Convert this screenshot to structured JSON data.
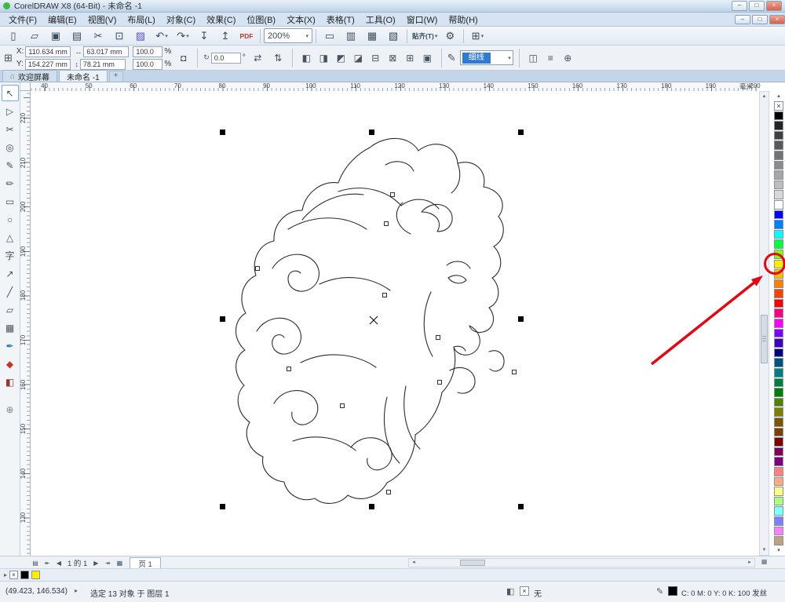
{
  "ui": {
    "drop_glyph": "▾"
  },
  "window": {
    "title": "CorelDRAW X8 (64-Bit) - 未命名 -1",
    "accent_green": "#43b649",
    "min_glyph": "–",
    "max_glyph": "□",
    "close_glyph": "×"
  },
  "menubar": {
    "items": [
      {
        "key": "file",
        "label": "文件(F)"
      },
      {
        "key": "edit",
        "label": "编辑(E)"
      },
      {
        "key": "view",
        "label": "视图(V)"
      },
      {
        "key": "layout",
        "label": "布局(L)"
      },
      {
        "key": "object",
        "label": "对象(C)"
      },
      {
        "key": "effects",
        "label": "效果(C)"
      },
      {
        "key": "bitmaps",
        "label": "位图(B)"
      },
      {
        "key": "text",
        "label": "文本(X)"
      },
      {
        "key": "table",
        "label": "表格(T)"
      },
      {
        "key": "tools",
        "label": "工具(O)"
      },
      {
        "key": "window",
        "label": "窗口(W)"
      },
      {
        "key": "help",
        "label": "帮助(H)"
      }
    ]
  },
  "toolbar": {
    "items": [
      {
        "name": "new-document-button",
        "glyph": "▯",
        "type": "icon"
      },
      {
        "name": "open-button",
        "glyph": "▱",
        "type": "icon"
      },
      {
        "name": "save-button",
        "glyph": "▣",
        "type": "icon"
      },
      {
        "name": "print-button",
        "glyph": "▤",
        "type": "icon"
      },
      {
        "name": "cut-button",
        "glyph": "✂",
        "type": "icon"
      },
      {
        "name": "copy-button",
        "glyph": "⊡",
        "type": "icon"
      },
      {
        "name": "paste-button",
        "glyph": "▨",
        "type": "icon",
        "accent": "#5a4fcf"
      },
      {
        "name": "undo-button",
        "glyph": "↶",
        "type": "icon-drop"
      },
      {
        "name": "redo-button",
        "glyph": "↷",
        "type": "icon-drop"
      },
      {
        "name": "import-button",
        "glyph": "↧",
        "type": "icon"
      },
      {
        "name": "export-button",
        "glyph": "↥",
        "type": "icon"
      },
      {
        "name": "publish-pdf-button",
        "glyph": "PDF",
        "type": "text",
        "accent": "#c0392b"
      },
      {
        "type": "sep"
      },
      {
        "name": "zoom-level-select",
        "glyph": "200%",
        "type": "select"
      },
      {
        "type": "sep"
      },
      {
        "name": "full-screen-preview-button",
        "glyph": "▭",
        "type": "icon"
      },
      {
        "name": "show-rulers-button",
        "glyph": "▥",
        "type": "icon"
      },
      {
        "name": "show-grid-button",
        "glyph": "▦",
        "type": "icon"
      },
      {
        "name": "show-guidelines-button",
        "glyph": "▧",
        "type": "icon"
      },
      {
        "type": "sep"
      },
      {
        "name": "snap-to-button",
        "glyph": "贴齐(T)",
        "type": "text-drop"
      },
      {
        "name": "options-button",
        "glyph": "⚙",
        "type": "icon"
      },
      {
        "type": "sep"
      },
      {
        "name": "application-launcher-button",
        "glyph": "⊞",
        "type": "icon-drop"
      }
    ]
  },
  "property_bar": {
    "position_icon_glyph": "⊞",
    "x_label": "X:",
    "x_value": "110.634 mm",
    "y_label": "Y:",
    "y_value": "154.227 mm",
    "width_icon": "↔",
    "width_value": "63.017 mm",
    "height_icon": "↕",
    "height_value": "78.21 mm",
    "scale_x": "100.0",
    "scale_y": "100.0",
    "percent": "%",
    "lock_glyph": "◘",
    "angle_icon": "↻",
    "angle_value": "0.0",
    "angle_unit": "°",
    "mirror_h_glyph": "⇄",
    "mirror_v_glyph": "⇅",
    "arrange_items": [
      {
        "name": "combine-button",
        "glyph": "◧"
      },
      {
        "name": "weld-button",
        "glyph": "◨"
      },
      {
        "name": "trim-button",
        "glyph": "◩"
      },
      {
        "name": "intersect-button",
        "glyph": "◪"
      },
      {
        "name": "simplify-button",
        "glyph": "⊟"
      },
      {
        "name": "front-minus-back-button",
        "glyph": "⊠"
      },
      {
        "name": "back-minus-front-button",
        "glyph": "⊞"
      },
      {
        "name": "create-boundary-button",
        "glyph": "▣"
      }
    ],
    "outline_pen_glyph": "✎",
    "outline_width_value": "细线",
    "extra_items": [
      {
        "name": "wrap-paragraph-text-button",
        "glyph": "◫"
      },
      {
        "name": "object-properties-button",
        "glyph": "≡"
      },
      {
        "name": "quick-customize-button",
        "glyph": "⊕"
      }
    ]
  },
  "doc_tabs": {
    "home_icon": "⌂",
    "welcome_label": "欢迎屏幕",
    "doc_label": "未命名 -1",
    "add_glyph": "+"
  },
  "rulers": {
    "unit": "毫米",
    "h_labels": [
      "40",
      "50",
      "60",
      "70",
      "80",
      "90",
      "100",
      "110",
      "120",
      "130",
      "140",
      "150",
      "160",
      "170",
      "180",
      "190",
      "200"
    ],
    "v_labels": [
      "220",
      "210",
      "200",
      "190",
      "180",
      "170",
      "160",
      "150",
      "140",
      "130"
    ]
  },
  "toolbox": {
    "tools": [
      {
        "name": "pick-tool",
        "glyph": "↖",
        "selected": true
      },
      {
        "name": "shape-tool",
        "glyph": "▷"
      },
      {
        "name": "crop-tool",
        "glyph": "✂"
      },
      {
        "name": "zoom-tool",
        "glyph": "◎"
      },
      {
        "name": "freehand-tool",
        "glyph": "✎"
      },
      {
        "name": "artistic-media-tool",
        "glyph": "✏"
      },
      {
        "name": "rectangle-tool",
        "glyph": "▭"
      },
      {
        "name": "ellipse-tool",
        "glyph": "○"
      },
      {
        "name": "polygon-tool",
        "glyph": "△"
      },
      {
        "name": "text-tool",
        "glyph": "字"
      },
      {
        "name": "parallel-dimension-tool",
        "glyph": "↗"
      },
      {
        "name": "connector-tool",
        "glyph": "╱"
      },
      {
        "name": "drop-shadow-tool",
        "glyph": "▱"
      },
      {
        "name": "transparency-tool",
        "glyph": "▦"
      },
      {
        "name": "color-eyedropper-tool",
        "glyph": "✒",
        "color": "#2a7ab5"
      },
      {
        "name": "interactive-fill-tool",
        "glyph": "◆",
        "color": "#c0392b"
      },
      {
        "name": "smart-fill-tool",
        "glyph": "◧",
        "color": "#8e3b2f"
      }
    ],
    "add_glyph": "⊕"
  },
  "palette": {
    "no_color_glyph": "×",
    "scroll_up_glyph": "▴",
    "scroll_down_glyph": "▾",
    "flyout_glyph": "▸",
    "circled_color": "#ffed00",
    "colors": [
      "#000000",
      "#262626",
      "#404040",
      "#595959",
      "#737373",
      "#8c8c8c",
      "#a6a6a6",
      "#bfbfbf",
      "#d9d9d9",
      "#ffffff",
      "#0000ff",
      "#0080ff",
      "#00ffff",
      "#00ff40",
      "#80ff00",
      "#ffed00",
      "#ffc000",
      "#ff8000",
      "#ff4000",
      "#ff0000",
      "#ff0080",
      "#ff00ff",
      "#8000ff",
      "#4000c0",
      "#000080",
      "#005580",
      "#008080",
      "#008040",
      "#008000",
      "#558000",
      "#808000",
      "#805500",
      "#804000",
      "#800000",
      "#800055",
      "#800080",
      "#ff8080",
      "#ffaa80",
      "#ffff80",
      "#aaff80",
      "#80ffff",
      "#8080ff",
      "#ff80ff",
      "#c0a080"
    ]
  },
  "scrollbars": {
    "up": "▴",
    "down": "▾",
    "left": "◂",
    "right": "▸"
  },
  "page_controls": {
    "doc_nav_icon": "▤",
    "first": "↞",
    "prev": "◀",
    "indicator": "1 的 1",
    "next": "▶",
    "last": "↠",
    "grid_icon": "▦",
    "page_tab": "页 1",
    "corner_glyph": "▦"
  },
  "doc_palette": {
    "flyout_glyph": "▸",
    "no_color_glyph": "×",
    "swatches": [
      "#000000",
      "#ffed00"
    ]
  },
  "status_bar": {
    "coords": "(49.423, 146.534)",
    "expand_glyph": "▸",
    "selection": "选定 13 对象 于 图层 1",
    "fill_icon": "◧",
    "fill_none_glyph": "×",
    "fill_label": "无",
    "outline_icon": "✎",
    "outline_swatch": "#000000",
    "outline_text": "C: 0 M: 0 Y: 0 K: 100 发丝"
  },
  "annotation": {
    "color": "#e30613"
  }
}
